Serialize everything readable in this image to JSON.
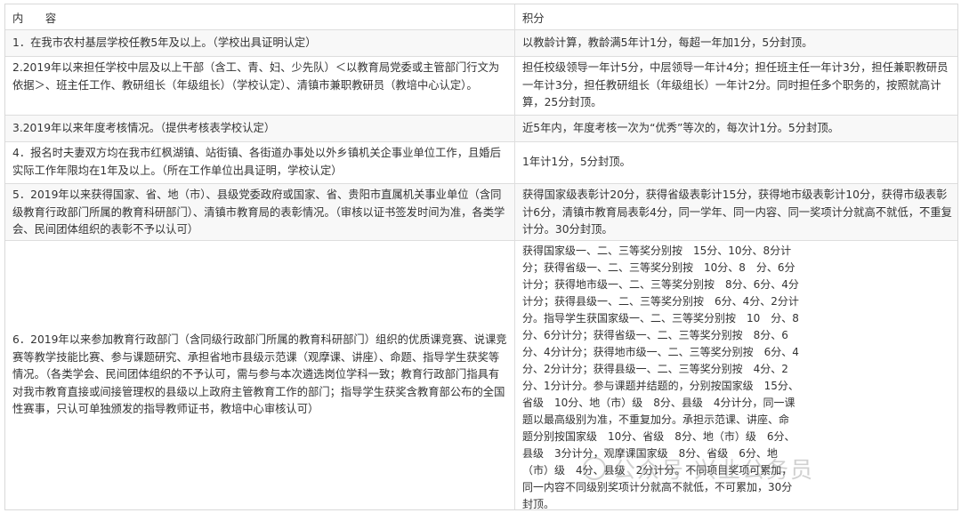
{
  "table": {
    "header": {
      "content": "内　　容",
      "score": "积分"
    },
    "rows": [
      {
        "content": "1．在我市农村基层学校任教5年及以上。（学校出具证明认定）",
        "score": "以教龄计算，教龄满5年计1分，每超一年加1分，5分封顶。"
      },
      {
        "content": "2.2019年以来担任学校中层及以上干部（含工、青、妇、少先队）＜以教育局党委或主管部门行文为依据＞、班主任工作、教研组长（年级组长）（学校认定）、清镇市兼职教研员（教培中心认定）。",
        "score": "担任校级领导一年计5分，中层领导一年计4分；担任班主任一年计3分，担任兼职教研员一年计3分，担任教研组长（年级组长）一年计2分。同时担任多个职务的，按照就高计算，25分封顶。"
      },
      {
        "content": "3.2019年以来年度考核情况。（提供考核表学校认定）",
        "score": "近5年内，年度考核一次为“优秀”等次的，每次计1分。5分封顶。"
      },
      {
        "content": "4．报名时夫妻双方均在我市红枫湖镇、站街镇、各街道办事处以外乡镇机关企事业单位工作，且婚后实际工作年限均在1年及以上。（所在工作单位出具证明，学校认定）",
        "score": "1年计1分，5分封顶。"
      },
      {
        "content": "5．2019年以来获得国家、省、地（市）、县级党委政府或国家、省、贵阳市直属机关事业单位（含同级教育行政部门所属的教育科研部门）、清镇市教育局的表彰情况。（审核以证书签发时间为准，各类学会、民间团体组织的表彰不予以认可）",
        "score": "获得国家级表彰计20分，获得省级表彰计15分，获得地市级表彰计10分，获得市级表彰计6分，清镇市教育局表彰4分，同一学年、同一内容、同一奖项计分就高不就低，不重复计分。30分封顶。"
      },
      {
        "content": "6．2019年以来参加教育行政部门（含同级行政部门所属的教育科研部门）组织的优质课竞赛、说课竞赛等教学技能比赛、参与课题研究、承担省地市县级示范课（观摩课、讲座）、命题、指导学生获奖等情况。（各类学会、民间团体组织的不予认可，需与参与本次遴选岗位学科一致；教育行政部门指具有对我市教育直接或间接管理权的县级以上政府主管教育工作的部门；指导学生获奖含教育部公布的全国性赛事，只认可单独颁发的指导教师证书，教培中心审核认可）",
        "score": "获得国家级一、二、三等奖分别按　15分、10分、8分计分；获得省级一、二、三等奖分别按　10分、8　分、6分计分；获得地市级一、二、三等奖分别按　8分、6分、4分计分；获得县级一、二、三等奖分别按　6分、4分、2分计分。指导学生获国家级一、二、三等奖分别按　10　分、8分、6分计分；获得省级一、二、三等奖分别按　8分、6分、4分计分；获得地市级一、二、三等奖分别按　6分、4分、2分计分；获得县级一、二、三等奖分别按　4分、2分、1分计分。参与课题并结题的，分别按国家级　15分、省级　10分、地（市）级　8分、县级　4分计分，同一课题以最高级别为准，不重复加分。承担示范课、讲座、命题分别按国家级　10分、省级　8分、地（市）级　6分、县级　3分计分，观摩课国家级　8分、省级　6分、地（市）级　4分、县级　2分计分。不同项目奖项可累加，同一内容不同级别奖项计分就高不就低，不可累加，30分封顶。"
      }
    ]
  },
  "watermark": {
    "text": "公众号·兴业公务员"
  }
}
